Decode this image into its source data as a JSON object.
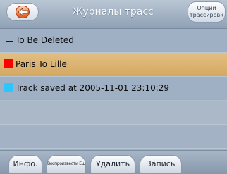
{
  "header": {
    "back_icon": "back-arrow-icon",
    "title": "Журналы трасс",
    "options_label": "Опции трассировк"
  },
  "tracks": [
    {
      "label": "To Be Deleted",
      "marker": "dash",
      "color": "#1a1a1a"
    },
    {
      "label": "Paris To Lille",
      "marker": "swatch",
      "color": "#ff0000"
    },
    {
      "label": "Track saved at 2005-11-01 23:10:29",
      "marker": "swatch",
      "color": "#29c6ff"
    }
  ],
  "footer": {
    "info_label": "Инфо.",
    "replay_label": "Воспроизвести Ещё",
    "delete_label": "Удалить",
    "record_label": "Запись"
  }
}
